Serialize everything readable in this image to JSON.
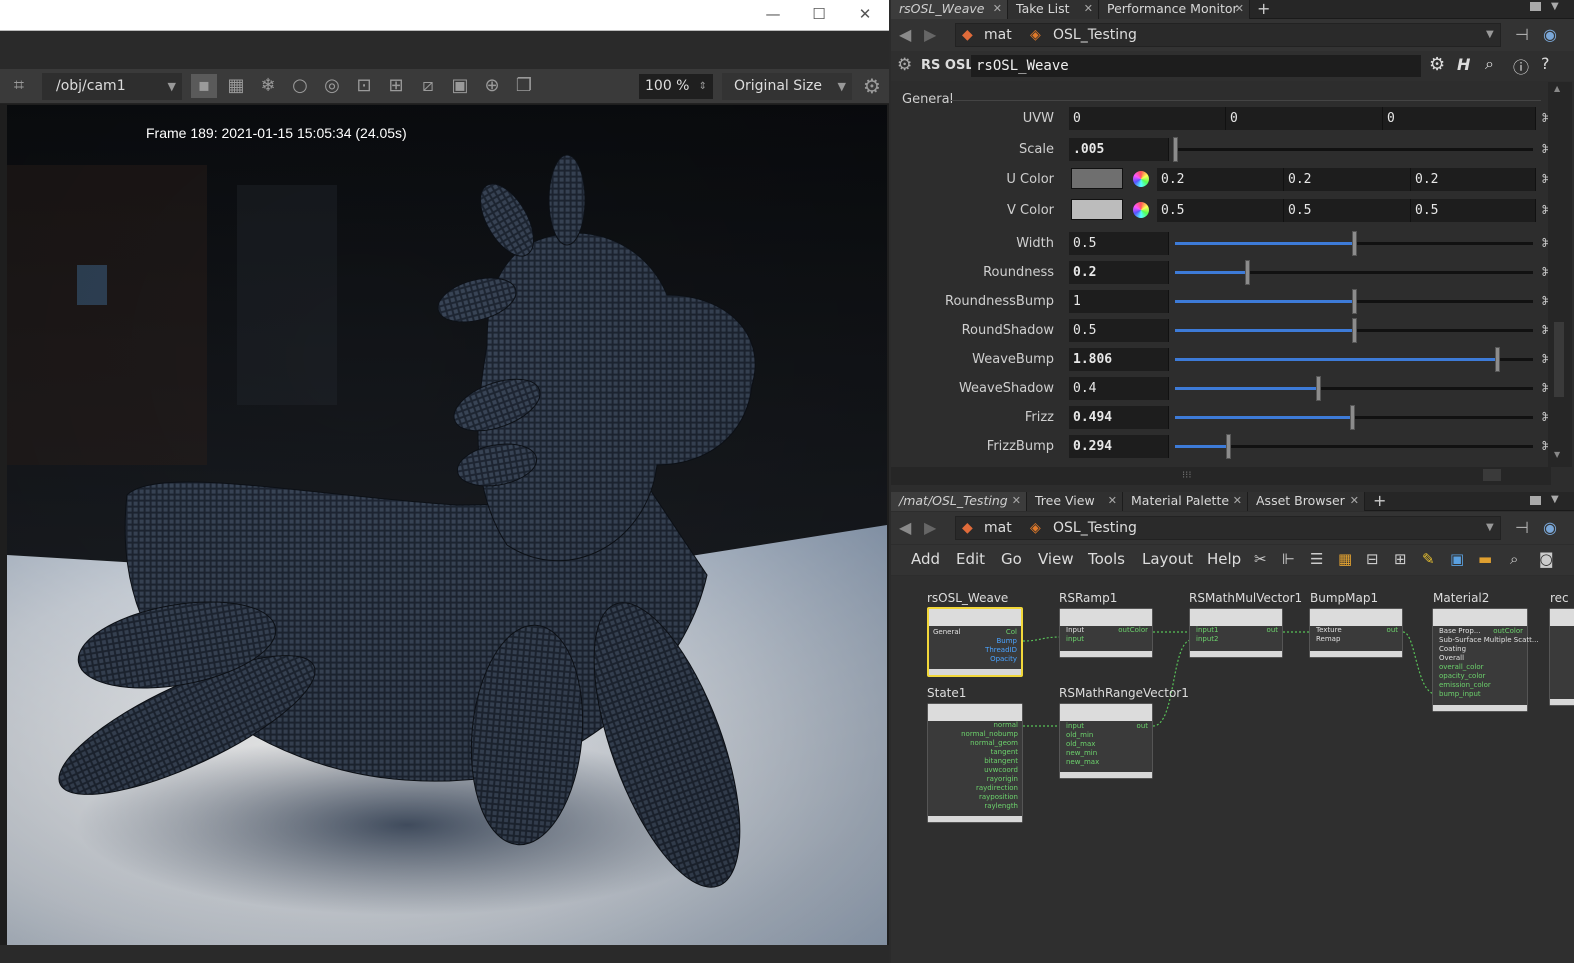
{
  "render_window": {
    "controls": {
      "minimize": "—",
      "maximize": "☐",
      "close": "✕"
    },
    "camera_path": "/obj/cam1",
    "zoom": "100 %",
    "size_mode": "Original Size",
    "frame_info": "Frame 189:  2021-01-15  15:05:34  (24.05s)"
  },
  "param_pane": {
    "tabs": [
      {
        "label": "rsOSL_Weave"
      },
      {
        "label": "Take List"
      },
      {
        "label": "Performance Monitor"
      }
    ],
    "path": {
      "network": "mat",
      "node": "OSL_Testing"
    },
    "node_type": "RS OSL",
    "node_name": "rsOSL_Weave",
    "folder": "General",
    "params": {
      "uvw": {
        "label": "UVW",
        "values": [
          "0",
          "0",
          "0"
        ]
      },
      "scale": {
        "label": "Scale",
        "value": ".005"
      },
      "u_color": {
        "label": "U Color",
        "swatch": "#6f6f6f",
        "values": [
          "0.2",
          "0.2",
          "0.2"
        ]
      },
      "v_color": {
        "label": "V Color",
        "swatch": "#bcbcbc",
        "values": [
          "0.5",
          "0.5",
          "0.5"
        ]
      },
      "sliders": [
        {
          "label": "Width",
          "value": "0.5",
          "level": 0.5,
          "bold": false
        },
        {
          "label": "Roundness",
          "value": "0.2",
          "level": 0.2,
          "bold": true
        },
        {
          "label": "RoundnessBump",
          "value": "1",
          "level": 0.5,
          "bold": false
        },
        {
          "label": "RoundShadow",
          "value": "0.5",
          "level": 0.5,
          "bold": false
        },
        {
          "label": "WeaveBump",
          "value": "1.806",
          "level": 0.9,
          "bold": true
        },
        {
          "label": "WeaveShadow",
          "value": "0.4",
          "level": 0.4,
          "bold": false
        },
        {
          "label": "Frizz",
          "value": "0.494",
          "level": 0.494,
          "bold": true
        },
        {
          "label": "FrizzBump",
          "value": "0.294",
          "level": 0.147,
          "bold": true
        }
      ]
    }
  },
  "network_pane": {
    "tabs": [
      {
        "label": "/mat/OSL_Testing"
      },
      {
        "label": "Tree View"
      },
      {
        "label": "Material Palette"
      },
      {
        "label": "Asset Browser"
      }
    ],
    "path": {
      "network": "mat",
      "node": "OSL_Testing"
    },
    "menu": [
      "Add",
      "Edit",
      "Go",
      "View",
      "Tools",
      "Layout",
      "Help"
    ],
    "nodes": {
      "weave": {
        "name": "rsOSL_Weave",
        "in": [
          "General"
        ],
        "out": [
          "Col",
          "Bump",
          "ThreadID",
          "Opacity"
        ]
      },
      "ramp": {
        "name": "RSRamp1",
        "in": [
          "Input",
          "input"
        ],
        "out": [
          "outColor"
        ]
      },
      "mulvec": {
        "name": "RSMathMulVector1",
        "in": [
          "input1",
          "input2"
        ],
        "out": [
          "out"
        ]
      },
      "bump": {
        "name": "BumpMap1",
        "in": [
          "Texture",
          "Remap"
        ],
        "out": [
          "out"
        ]
      },
      "material": {
        "name": "Material2",
        "in": [
          "Base Prop...",
          "Sub-Surface Multiple Scatt...",
          "Coating",
          "Overall",
          "overall_color",
          "opacity_color",
          "emission_color",
          "bump_input"
        ],
        "out": [
          "outColor"
        ]
      },
      "state": {
        "name": "State1",
        "out": [
          "normal",
          "normal_nobump",
          "normal_geom",
          "tangent",
          "bitangent",
          "uvwcoord",
          "rayorigin",
          "raydirection",
          "rayposition",
          "raylength"
        ]
      },
      "range": {
        "name": "RSMathRangeVector1",
        "in": [
          "input",
          "old_min",
          "old_max",
          "new_min",
          "new_max"
        ],
        "out": [
          "out"
        ]
      },
      "partial": {
        "name": "rec"
      }
    }
  }
}
